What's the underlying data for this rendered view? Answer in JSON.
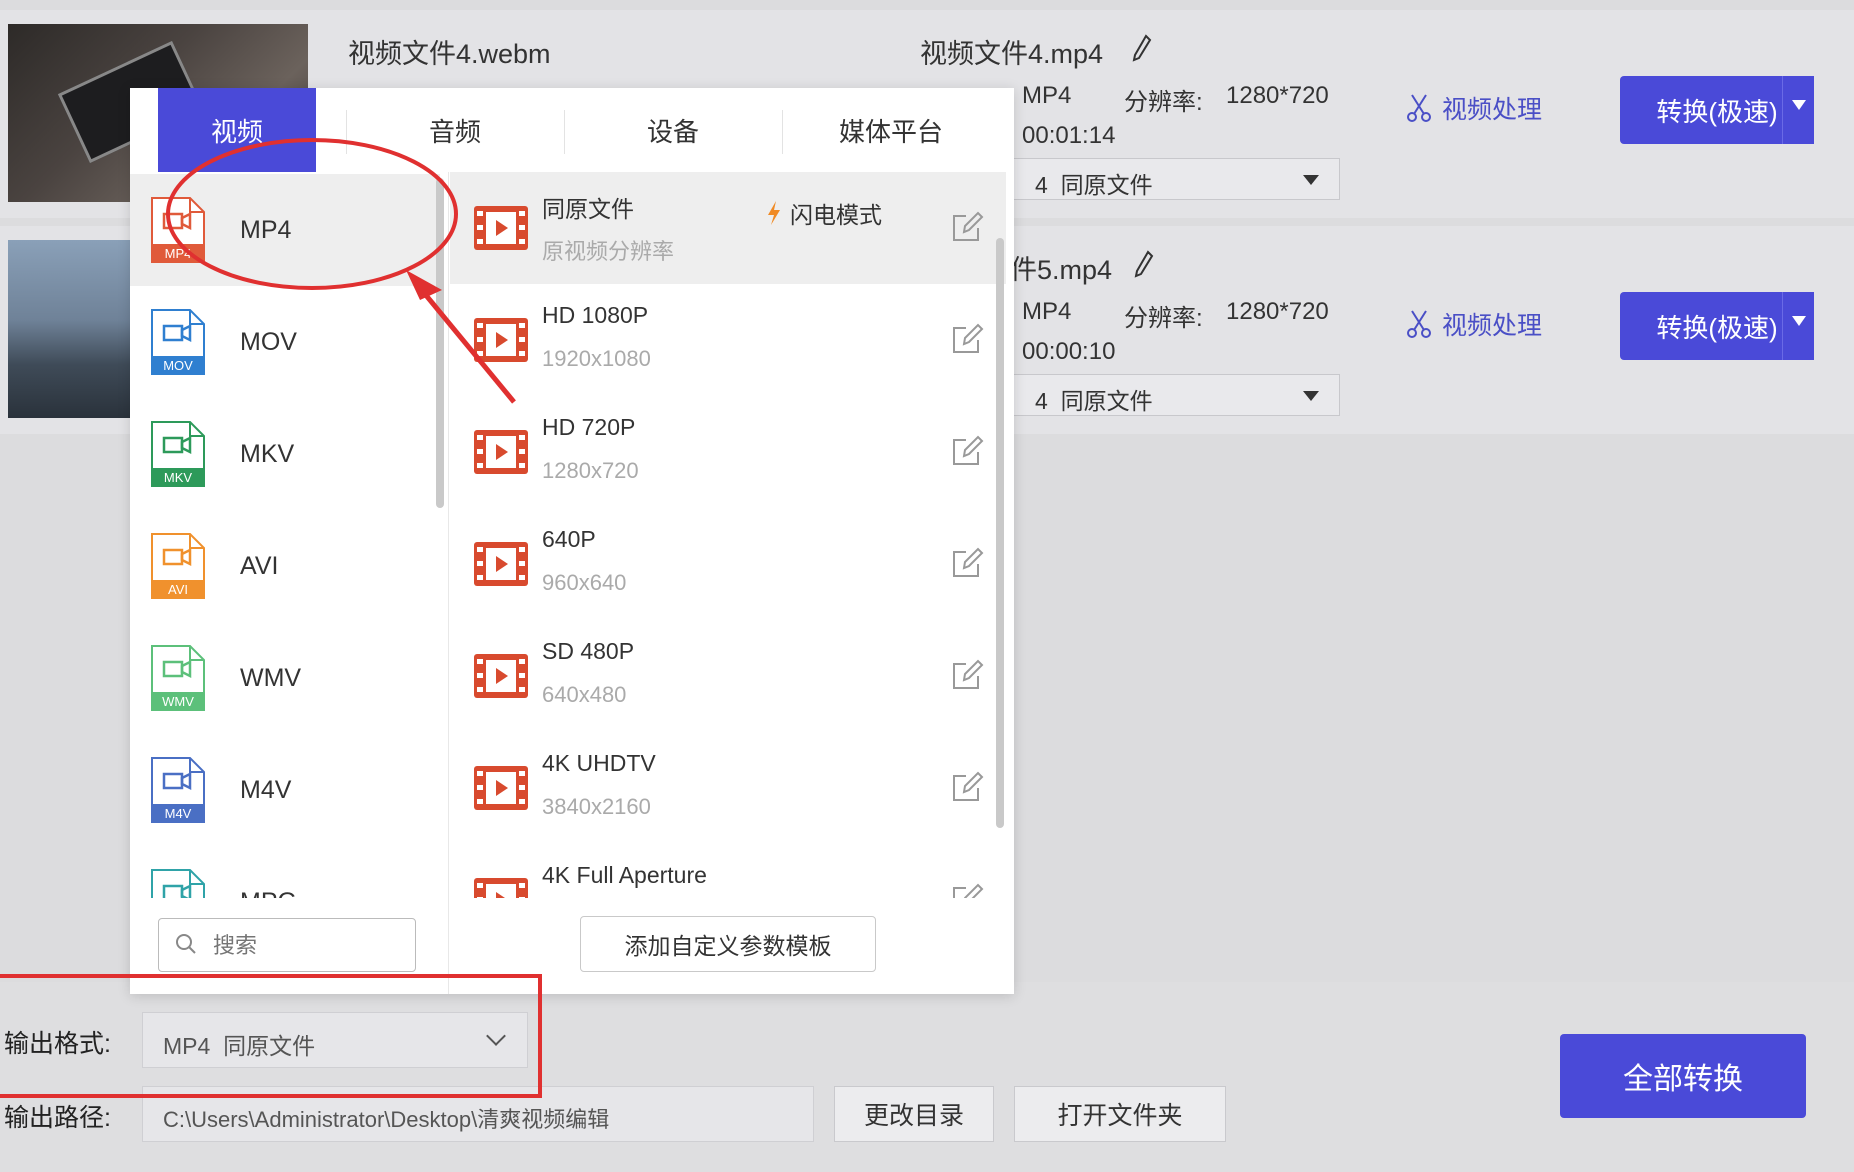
{
  "files": [
    {
      "source_name": "视频文件4.webm",
      "output_name": "视频文件4.mp4",
      "format": "MP4",
      "resolution_label": "分辨率:",
      "resolution": "1280*720",
      "duration": "00:01:14",
      "preset_prefix": "4",
      "preset": "同原文件",
      "process_label": "视频处理",
      "convert_label": "转换(极速)"
    },
    {
      "output_name": "件5.mp4",
      "format": "MP4",
      "resolution_label": "分辨率:",
      "resolution": "1280*720",
      "duration": "00:00:10",
      "preset_prefix": "4",
      "preset": "同原文件",
      "process_label": "视频处理",
      "convert_label": "转换(极速)"
    }
  ],
  "popup": {
    "tabs": [
      "视频",
      "音频",
      "设备",
      "媒体平台"
    ],
    "active_tab": "视频",
    "formats": [
      {
        "name": "MP4",
        "badge": "MP4",
        "color": "#e05a3a",
        "selected": true
      },
      {
        "name": "MOV",
        "badge": "MOV",
        "color": "#2f7fd0",
        "selected": false
      },
      {
        "name": "MKV",
        "badge": "MKV",
        "color": "#2d9a5a",
        "selected": false
      },
      {
        "name": "AVI",
        "badge": "AVI",
        "color": "#f0912d",
        "selected": false
      },
      {
        "name": "WMV",
        "badge": "WMV",
        "color": "#5cc07a",
        "selected": false
      },
      {
        "name": "M4V",
        "badge": "M4V",
        "color": "#4a6fc4",
        "selected": false
      },
      {
        "name": "MPG",
        "badge": "",
        "color": "#2fa3a8",
        "selected": false
      }
    ],
    "presets": [
      {
        "title": "同原文件",
        "sub": "原视频分辨率",
        "lightning": "闪电模式"
      },
      {
        "title": "HD 1080P",
        "sub": "1920x1080"
      },
      {
        "title": "HD 720P",
        "sub": "1280x720"
      },
      {
        "title": "640P",
        "sub": "960x640"
      },
      {
        "title": "SD 480P",
        "sub": "640x480"
      },
      {
        "title": "4K UHDTV",
        "sub": "3840x2160"
      },
      {
        "title": "4K Full Aperture",
        "sub": ""
      }
    ],
    "search_placeholder": "搜索",
    "add_template_label": "添加自定义参数模板"
  },
  "bottom": {
    "output_format_label": "输出格式:",
    "output_format_value": "MP4  同原文件",
    "output_path_label": "输出路径:",
    "output_path_value": "C:\\Users\\Administrator\\Desktop\\清爽视频编辑",
    "change_dir_label": "更改目录",
    "open_folder_label": "打开文件夹",
    "convert_all_label": "全部转换"
  },
  "colors": {
    "accent": "#4a4ad8",
    "annotation_red": "#e03030"
  }
}
